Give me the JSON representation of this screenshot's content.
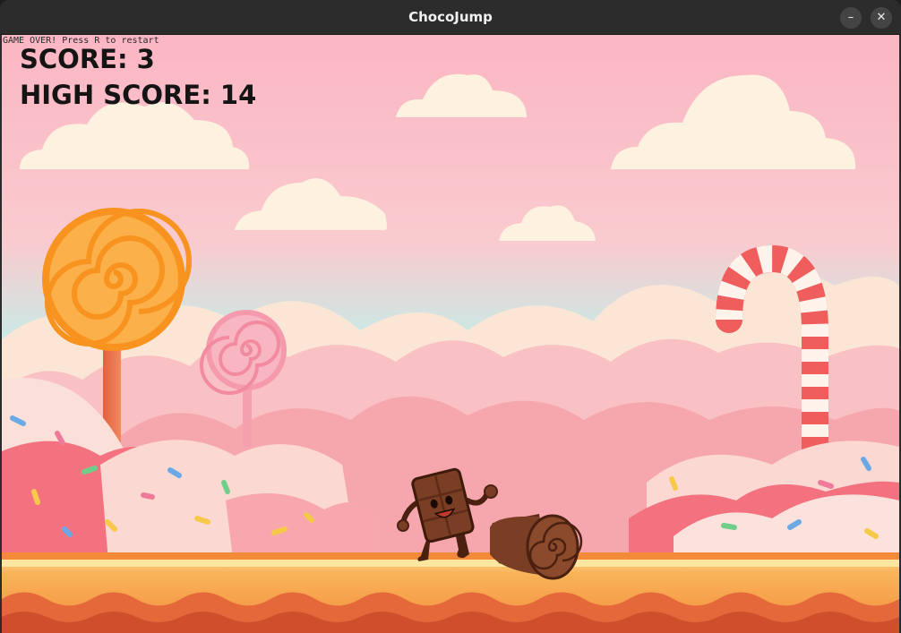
{
  "window": {
    "title": "ChocoJump",
    "minimize_glyph": "–",
    "close_glyph": "✕"
  },
  "hud": {
    "status_message": "GAME OVER! Press R to restart",
    "score_text": "SCORE: 3",
    "high_score_text": "HIGH SCORE: 14"
  },
  "colors": {
    "sky_top": "#fbb9c4",
    "sky_mid": "#bfe9e6",
    "ground": "#f7a248",
    "ground_dark": "#d9582f",
    "chocolate": "#7a3e24"
  },
  "icons": {
    "minimize": "minimize-icon",
    "close": "close-icon"
  }
}
